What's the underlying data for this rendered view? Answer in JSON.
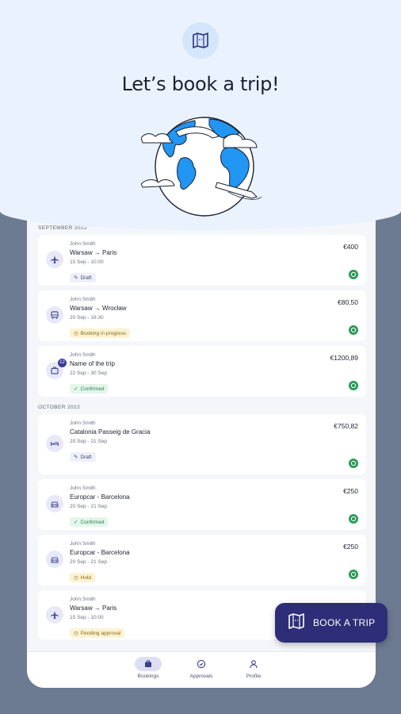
{
  "header": {
    "title": "Let’s book a trip!",
    "badge_icon": "map-icon"
  },
  "sections": [
    {
      "label": "SEPTEMBER 2022",
      "bookings": [
        {
          "person": "John Smith",
          "route": "Warsaw → Paris",
          "dates": "15 Sep - 10:00",
          "status": "Draft",
          "price": "€400",
          "icon": "plane-icon"
        },
        {
          "person": "John Smith",
          "route": "Warsaw → Wrocław",
          "dates": "20 Sep - 16:30",
          "status": "Booking in progress",
          "price": "€80,50",
          "icon": "train-icon"
        },
        {
          "person": "John Smith",
          "route": "Name of the trip",
          "dates": "22 Sep - 30 Sep",
          "status": "Confirmed",
          "price": "€1200,89",
          "icon": "suitcase-icon",
          "badge": "12"
        }
      ]
    },
    {
      "label": "OCTOBER 2022",
      "bookings": [
        {
          "person": "John Smith",
          "route": "Catalonia Passeig de Gracia",
          "dates": "20 Sep - 21 Sep",
          "status": "Draft",
          "price": "€750,82",
          "icon": "bed-icon"
        },
        {
          "person": "John Smith",
          "route": "Europcar - Barcelona",
          "dates": "20 Sep - 21 Sep",
          "status": "Confirmed",
          "price": "€250",
          "icon": "car-icon"
        },
        {
          "person": "John Smith",
          "route": "Europcar - Barcelona",
          "dates": "20 Sep - 21 Sep",
          "status": "Hold",
          "price": "€250",
          "icon": "car-icon"
        },
        {
          "person": "John Smith",
          "route": "Warsaw → Paris",
          "dates": "15 Sep - 10:00",
          "status": "Pending approval",
          "price": "",
          "icon": "plane-icon"
        }
      ]
    }
  ],
  "tabs": [
    {
      "label": "Bookings",
      "icon": "suitcase-icon",
      "active": true
    },
    {
      "label": "Approvals",
      "icon": "check-circle-icon",
      "active": false
    },
    {
      "label": "Profile",
      "icon": "person-icon",
      "active": false
    }
  ],
  "fab": {
    "label": "BOOK A TRIP",
    "icon": "map-icon"
  },
  "colors": {
    "hero_bg": "#eaf3fd",
    "accent": "#2e2e78",
    "globe_blue": "#2196f3",
    "policy_green": "#2b9a57",
    "backdrop": "#6c7a92"
  }
}
